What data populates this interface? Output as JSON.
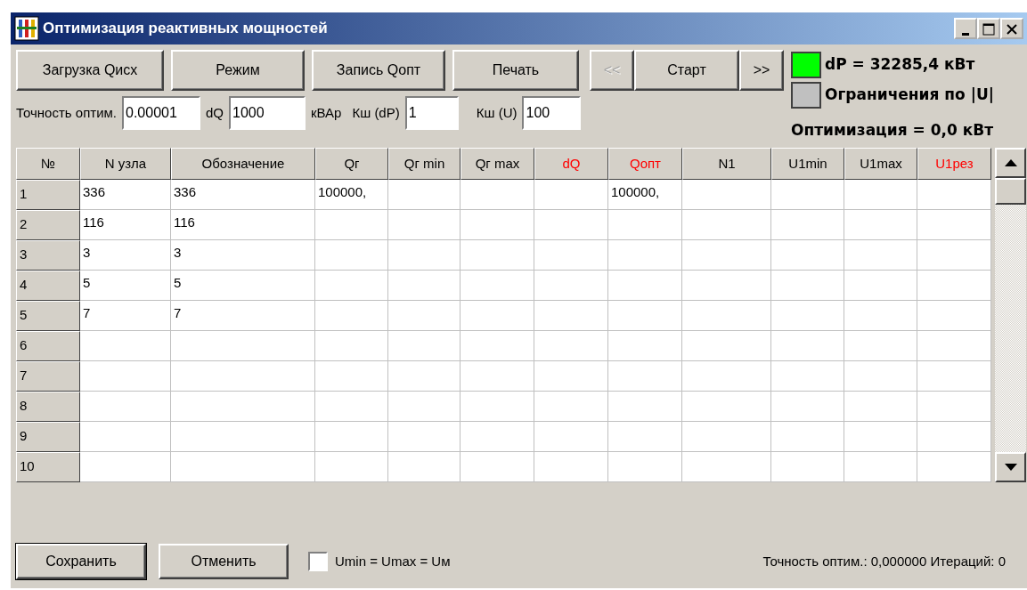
{
  "window": {
    "title": "Оптимизация реактивных мощностей"
  },
  "toolbar": [
    {
      "label": "Загрузка Qисх",
      "disabled": false
    },
    {
      "label": "Режим",
      "disabled": false
    },
    {
      "label": "Запись Qопт",
      "disabled": false
    },
    {
      "label": "Печать",
      "disabled": false
    }
  ],
  "nav": [
    {
      "label": "<<",
      "disabled": true
    },
    {
      "label": "Старт",
      "disabled": false
    },
    {
      "label": ">>",
      "disabled": false
    }
  ],
  "indicators": [
    {
      "color": "#00ff00",
      "text": "dP = 32285,4 кВт"
    },
    {
      "color": "#c0c0c0",
      "text": "Ограничения по |U|"
    }
  ],
  "params": [
    {
      "label": "Точность оптим.",
      "value": "0.00001"
    },
    {
      "label": "dQ",
      "value": "1000",
      "unit": "кВАр"
    },
    {
      "label": "Кш (dP)",
      "value": "1"
    },
    {
      "label": "Кш (U)",
      "value": "100"
    }
  ],
  "optimization_result": "Оптимизация = 0,0 кВт",
  "table": {
    "columns": [
      {
        "title": "№",
        "highlight": false
      },
      {
        "title": "N узла",
        "highlight": false
      },
      {
        "title": "Обозначение",
        "highlight": false
      },
      {
        "title": "Qг",
        "highlight": false
      },
      {
        "title": "Qг min",
        "highlight": false
      },
      {
        "title": "Qг max",
        "highlight": false
      },
      {
        "title": "dQ",
        "highlight": true
      },
      {
        "title": "Qопт",
        "highlight": true
      },
      {
        "title": "N1",
        "highlight": false
      },
      {
        "title": "U1min",
        "highlight": false
      },
      {
        "title": "U1max",
        "highlight": false
      },
      {
        "title": "U1рез",
        "highlight": true
      }
    ],
    "rows": [
      {
        "cells": [
          "1",
          "336",
          "336",
          "100000,",
          "",
          "",
          "",
          "100000,",
          "",
          "",
          "",
          ""
        ]
      },
      {
        "cells": [
          "2",
          "116",
          "116",
          "",
          "",
          "",
          "",
          "",
          "",
          "",
          "",
          ""
        ]
      },
      {
        "cells": [
          "3",
          "3",
          "3",
          "",
          "",
          "",
          "",
          "",
          "",
          "",
          "",
          ""
        ]
      },
      {
        "cells": [
          "4",
          "5",
          "5",
          "",
          "",
          "",
          "",
          "",
          "",
          "",
          "",
          ""
        ]
      },
      {
        "cells": [
          "5",
          "7",
          "7",
          "",
          "",
          "",
          "",
          "",
          "",
          "",
          "",
          ""
        ]
      },
      {
        "cells": [
          "6",
          "",
          "",
          "",
          "",
          "",
          "",
          "",
          "",
          "",
          "",
          ""
        ]
      },
      {
        "cells": [
          "7",
          "",
          "",
          "",
          "",
          "",
          "",
          "",
          "",
          "",
          "",
          ""
        ]
      },
      {
        "cells": [
          "8",
          "",
          "",
          "",
          "",
          "",
          "",
          "",
          "",
          "",
          "",
          ""
        ]
      },
      {
        "cells": [
          "9",
          "",
          "",
          "",
          "",
          "",
          "",
          "",
          "",
          "",
          "",
          ""
        ]
      },
      {
        "cells": [
          "10",
          "",
          "",
          "",
          "",
          "",
          "",
          "",
          "",
          "",
          "",
          ""
        ]
      }
    ]
  },
  "footer": {
    "buttons": [
      {
        "label": "Сохранить",
        "default": true
      },
      {
        "label": "Отменить",
        "default": false
      }
    ],
    "checkbox": {
      "label": "Umin = Umax = Uм",
      "checked": false
    },
    "status": "Точность оптим.: 0,000000 Итераций: 0"
  }
}
